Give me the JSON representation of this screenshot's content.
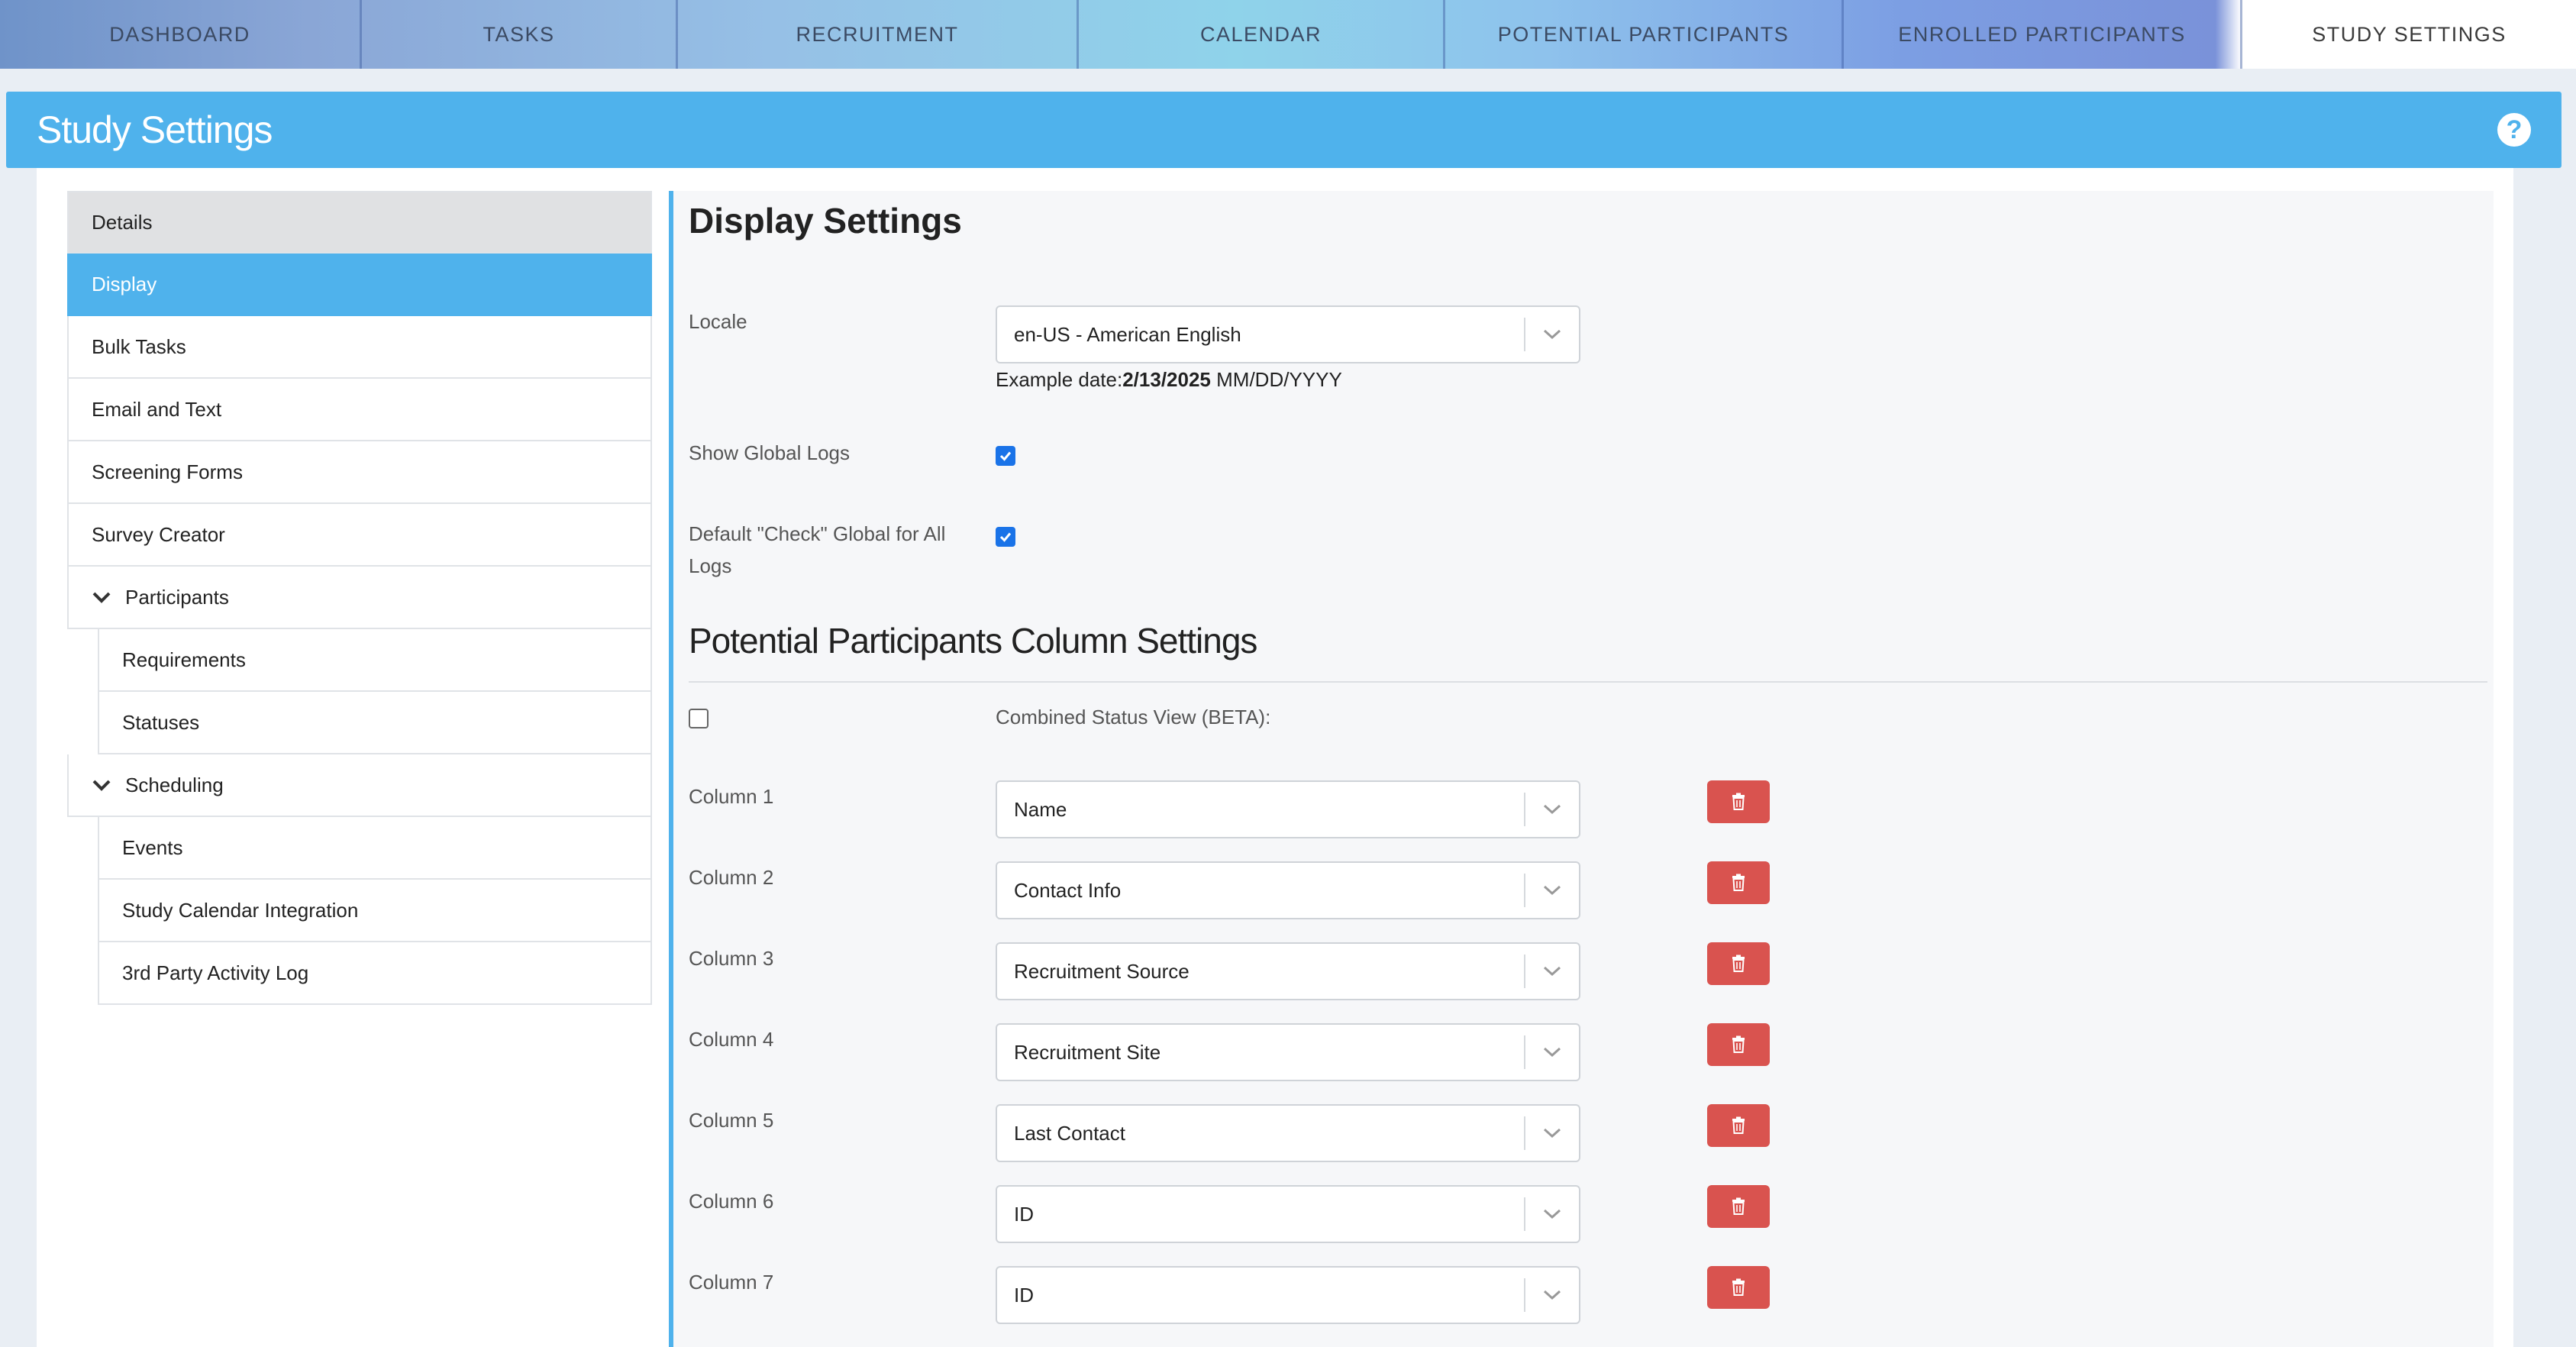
{
  "nav": {
    "tabs": [
      {
        "label": "DASHBOARD"
      },
      {
        "label": "TASKS"
      },
      {
        "label": "RECRUITMENT"
      },
      {
        "label": "CALENDAR"
      },
      {
        "label": "POTENTIAL PARTICIPANTS"
      },
      {
        "label": "ENROLLED PARTICIPANTS"
      },
      {
        "label": "STUDY SETTINGS",
        "active": true
      }
    ]
  },
  "header": {
    "title": "Study Settings",
    "help_icon": "question-circle-icon"
  },
  "sidebar": {
    "items": [
      {
        "label": "Details"
      },
      {
        "label": "Display",
        "active": true
      },
      {
        "label": "Bulk Tasks"
      },
      {
        "label": "Email and Text"
      },
      {
        "label": "Screening Forms"
      },
      {
        "label": "Survey Creator"
      },
      {
        "label": "Participants",
        "expanded": true
      },
      {
        "label": "Requirements"
      },
      {
        "label": "Statuses"
      },
      {
        "label": "Scheduling",
        "expanded": true
      },
      {
        "label": "Events"
      },
      {
        "label": "Study Calendar Integration"
      },
      {
        "label": "3rd Party Activity Log"
      }
    ]
  },
  "display": {
    "title": "Display Settings",
    "locale": {
      "label": "Locale",
      "value": "en-US - American English",
      "example_prefix": "Example date:",
      "example_date": "2/13/2025",
      "example_format": "MM/DD/YYYY"
    },
    "show_global_logs": {
      "label": "Show Global Logs",
      "checked": true
    },
    "default_check_global": {
      "label": "Default \"Check\" Global for All Logs",
      "checked": true
    }
  },
  "columns_section": {
    "title": "Potential Participants Column Settings",
    "combined_status": {
      "label": "Combined Status View (BETA):",
      "checked": false
    },
    "columns": [
      {
        "label": "Column 1",
        "value": "Name"
      },
      {
        "label": "Column 2",
        "value": "Contact Info"
      },
      {
        "label": "Column 3",
        "value": "Recruitment Source"
      },
      {
        "label": "Column 4",
        "value": "Recruitment Site"
      },
      {
        "label": "Column 5",
        "value": "Last Contact"
      },
      {
        "label": "Column 6",
        "value": "ID"
      },
      {
        "label": "Column 7",
        "value": "ID"
      }
    ]
  },
  "colors": {
    "accent": "#4fb2ec",
    "danger": "#d9534f",
    "checkbox": "#1a73e8"
  }
}
